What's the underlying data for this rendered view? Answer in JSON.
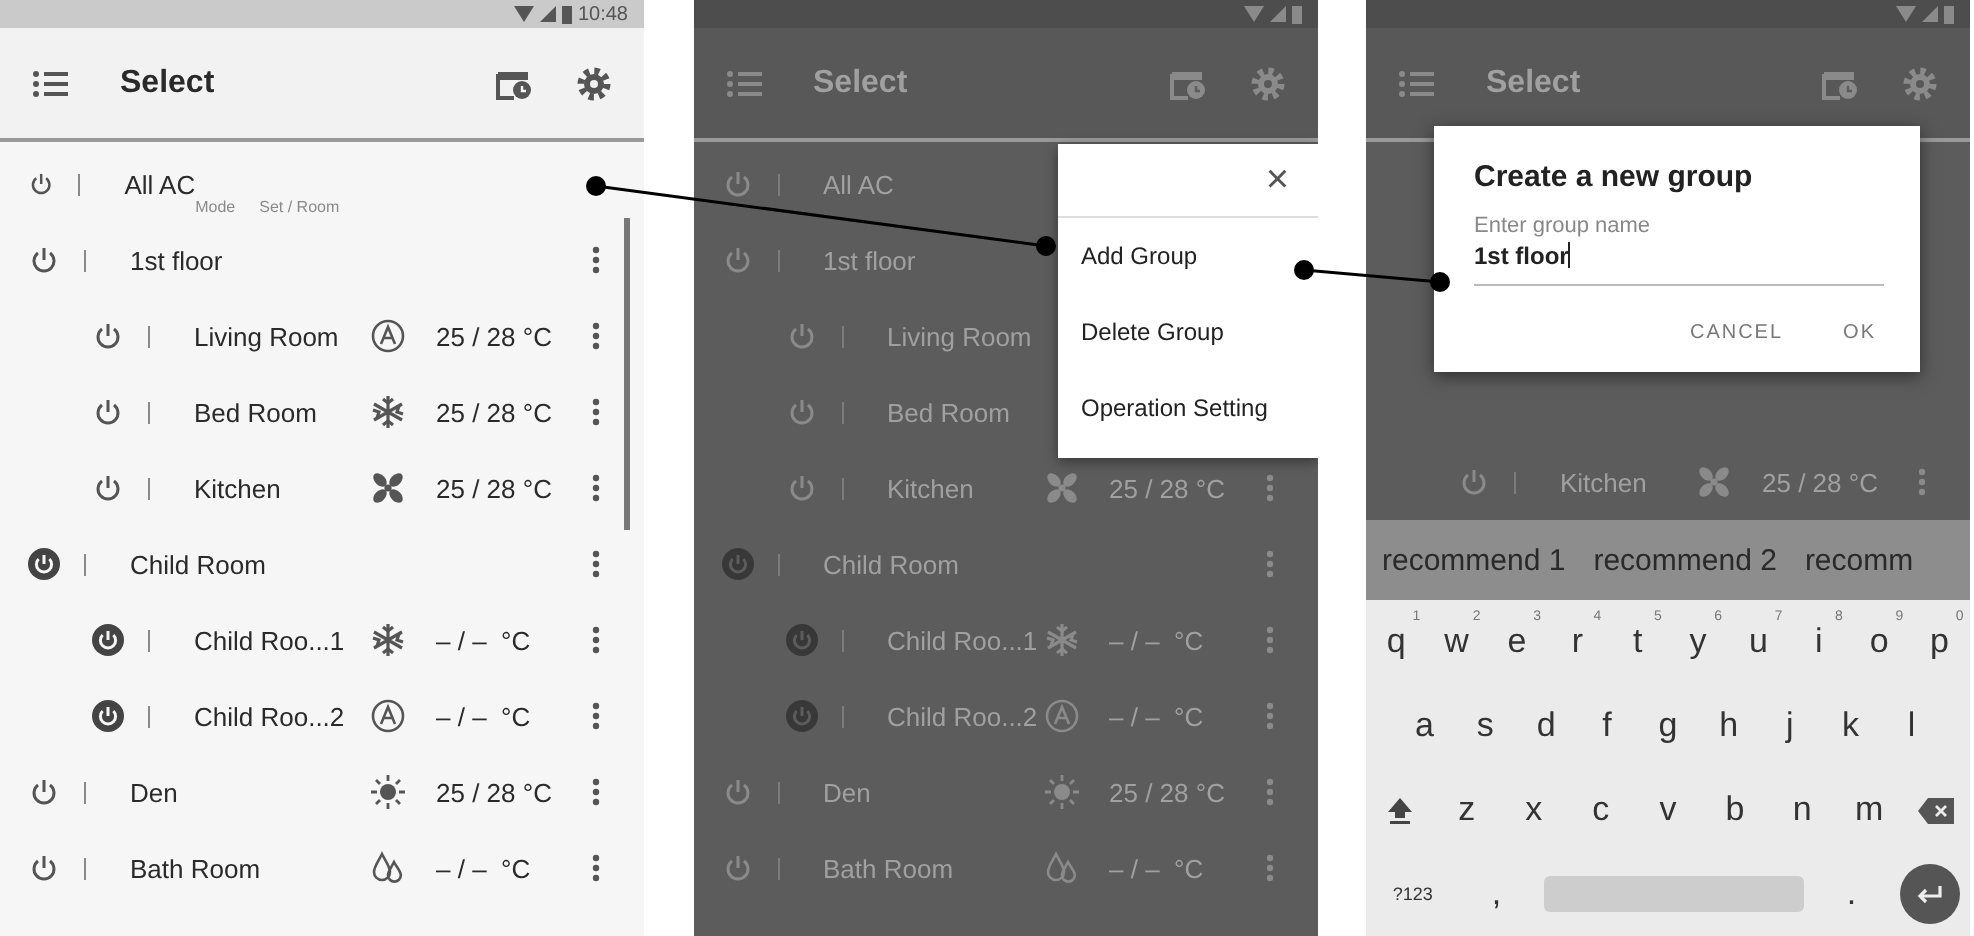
{
  "screens": [
    {
      "dimmed": false,
      "status_bar": {
        "time": "10:48"
      },
      "app_bar": {
        "title": "Select"
      },
      "list_header": {
        "mode": "Mode",
        "set_room": "Set / Room"
      },
      "rows": [
        {
          "name": "All AC",
          "on": false,
          "more": false
        },
        {
          "name": "1st floor",
          "on": false,
          "more": true,
          "children": [
            {
              "name": "Living Room",
              "on": false,
              "kind": "auto",
              "temp": "25 / 28 °C",
              "more": true
            },
            {
              "name": "Bed Room",
              "on": false,
              "kind": "cool",
              "temp": "25 / 28 °C",
              "more": true
            },
            {
              "name": "Kitchen",
              "on": false,
              "kind": "fan",
              "temp": "25 / 28 °C",
              "more": true
            }
          ]
        },
        {
          "name": "Child Room",
          "on": true,
          "more": true,
          "children": [
            {
              "name": "Child Roo...1",
              "on": true,
              "kind": "cool",
              "temp": "– / –  °C",
              "more": true
            },
            {
              "name": "Child Roo...2",
              "on": true,
              "kind": "auto",
              "temp": "– / –  °C",
              "more": true
            }
          ]
        },
        {
          "name": "Den",
          "on": false,
          "kind": "heat",
          "temp": "25 / 28 °C",
          "more": true
        },
        {
          "name": "Bath Room",
          "on": false,
          "kind": "dry",
          "temp": "– / –  °C",
          "more": true
        }
      ]
    },
    {
      "dimmed": true,
      "app_bar": {
        "title": "Select"
      },
      "rows": [
        {
          "name": "All AC",
          "on": false,
          "more": false
        },
        {
          "name": "1st floor",
          "on": false,
          "more": false,
          "children": [
            {
              "name": "Living Room",
              "on": false,
              "more": false
            },
            {
              "name": "Bed Room",
              "on": false,
              "more": false
            },
            {
              "name": "Kitchen",
              "on": false,
              "kind": "fan",
              "temp": "25 / 28 °C",
              "more": true
            }
          ]
        },
        {
          "name": "Child Room",
          "on": true,
          "more": true,
          "children": [
            {
              "name": "Child Roo...1",
              "on": true,
              "kind": "cool",
              "temp": "– / –  °C",
              "more": true
            },
            {
              "name": "Child Roo...2",
              "on": true,
              "kind": "auto",
              "temp": "– / –  °C",
              "more": true
            }
          ]
        },
        {
          "name": "Den",
          "on": false,
          "kind": "heat",
          "temp": "25 / 28 °C",
          "more": true
        },
        {
          "name": "Bath Room",
          "on": false,
          "kind": "dry",
          "temp": "– / –  °C",
          "more": true
        }
      ],
      "menu": {
        "close": "×",
        "items": [
          "Add Group",
          "Delete Group",
          "Operation Setting"
        ]
      }
    },
    {
      "dimmed": true,
      "app_bar": {
        "title": "Select"
      },
      "rows": [
        {
          "children": [
            {
              "name": "Kitchen",
              "on": false,
              "kind": "fan",
              "temp": "25 / 28 °C",
              "more": true
            }
          ]
        }
      ],
      "dialog": {
        "title": "Create a new group",
        "label": "Enter group name",
        "value": "1st floor",
        "buttons": [
          "CANCEL",
          "OK"
        ]
      },
      "keyboard": {
        "suggestions": [
          "recommend 1",
          "recommend 2",
          "recomm"
        ],
        "rows": [
          [
            {
              "kind": "char",
              "label": "q",
              "hint": "1"
            },
            {
              "kind": "char",
              "label": "w",
              "hint": "2"
            },
            {
              "kind": "char",
              "label": "e",
              "hint": "3"
            },
            {
              "kind": "char",
              "label": "r",
              "hint": "4"
            },
            {
              "kind": "char",
              "label": "t",
              "hint": "5"
            },
            {
              "kind": "char",
              "label": "y",
              "hint": "6"
            },
            {
              "kind": "char",
              "label": "u",
              "hint": "7"
            },
            {
              "kind": "char",
              "label": "i",
              "hint": "8"
            },
            {
              "kind": "char",
              "label": "o",
              "hint": "9"
            },
            {
              "kind": "char",
              "label": "p",
              "hint": "0"
            }
          ],
          [
            {
              "kind": "char",
              "label": "a"
            },
            {
              "kind": "char",
              "label": "s"
            },
            {
              "kind": "char",
              "label": "d"
            },
            {
              "kind": "char",
              "label": "f"
            },
            {
              "kind": "char",
              "label": "g"
            },
            {
              "kind": "char",
              "label": "h"
            },
            {
              "kind": "char",
              "label": "j"
            },
            {
              "kind": "char",
              "label": "k"
            },
            {
              "kind": "char",
              "label": "l"
            }
          ],
          [
            {
              "kind": "shift"
            },
            {
              "kind": "char",
              "label": "z"
            },
            {
              "kind": "char",
              "label": "x"
            },
            {
              "kind": "char",
              "label": "c"
            },
            {
              "kind": "char",
              "label": "v"
            },
            {
              "kind": "char",
              "label": "b"
            },
            {
              "kind": "char",
              "label": "n"
            },
            {
              "kind": "char",
              "label": "m"
            },
            {
              "kind": "backspace"
            }
          ],
          [
            {
              "kind": "symbols",
              "label": "?123"
            },
            {
              "kind": "char",
              "label": ","
            },
            {
              "kind": "space"
            },
            {
              "kind": "char",
              "label": "."
            },
            {
              "kind": "enter"
            }
          ]
        ]
      }
    }
  ]
}
